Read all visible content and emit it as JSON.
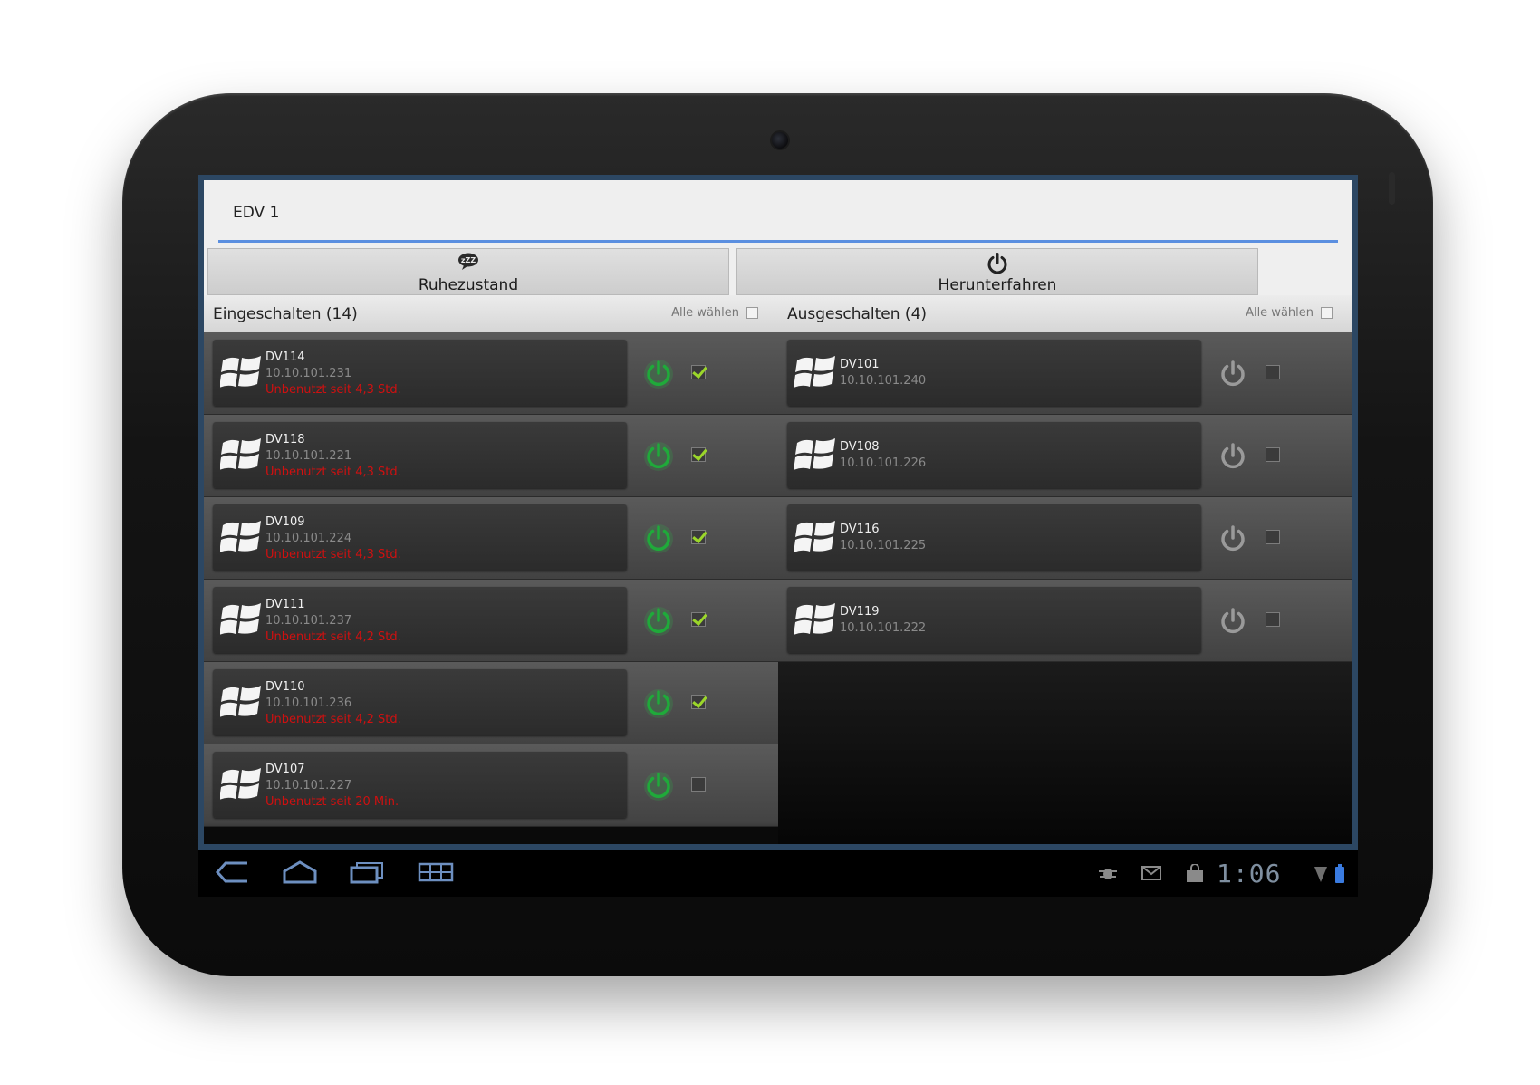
{
  "app": {
    "title": "EDV 1",
    "accent_color": "#5b8fe0",
    "frame_color": "#2c4763"
  },
  "actions": {
    "sleep": {
      "label": "Ruhezustand",
      "icon": "sleep-zzz-icon"
    },
    "shutdown": {
      "label": "Herunterfahren",
      "icon": "power-icon"
    }
  },
  "online": {
    "header": "Eingeschalten (14)",
    "select_all_label": "Alle wählen",
    "power_color": "#1faa3a",
    "devices": [
      {
        "name": "DV114",
        "ip": "10.10.101.231",
        "idle": "Unbenutzt seit 4,3 Std.",
        "checked": true
      },
      {
        "name": "DV118",
        "ip": "10.10.101.221",
        "idle": "Unbenutzt seit 4,3 Std.",
        "checked": true
      },
      {
        "name": "DV109",
        "ip": "10.10.101.224",
        "idle": "Unbenutzt seit 4,3 Std.",
        "checked": true
      },
      {
        "name": "DV111",
        "ip": "10.10.101.237",
        "idle": "Unbenutzt seit 4,2 Std.",
        "checked": true
      },
      {
        "name": "DV110",
        "ip": "10.10.101.236",
        "idle": "Unbenutzt seit 4,2 Std.",
        "checked": true
      },
      {
        "name": "DV107",
        "ip": "10.10.101.227",
        "idle": "Unbenutzt seit 20 Min.",
        "checked": false
      }
    ]
  },
  "offline": {
    "header": "Ausgeschalten (4)",
    "select_all_label": "Alle wählen",
    "power_color": "#9a9a9a",
    "devices": [
      {
        "name": "DV101",
        "ip": "10.10.101.240",
        "checked": false
      },
      {
        "name": "DV108",
        "ip": "10.10.101.226",
        "checked": false
      },
      {
        "name": "DV116",
        "ip": "10.10.101.225",
        "checked": false
      },
      {
        "name": "DV119",
        "ip": "10.10.101.222",
        "checked": false
      }
    ]
  },
  "system_bar": {
    "clock": "1:06",
    "nav": [
      "back-icon",
      "home-icon",
      "recent-apps-icon",
      "screenshot-icon"
    ],
    "tray": [
      "debug-icon",
      "mail-icon",
      "store-bag-icon",
      "wifi-icon",
      "battery-icon"
    ]
  }
}
